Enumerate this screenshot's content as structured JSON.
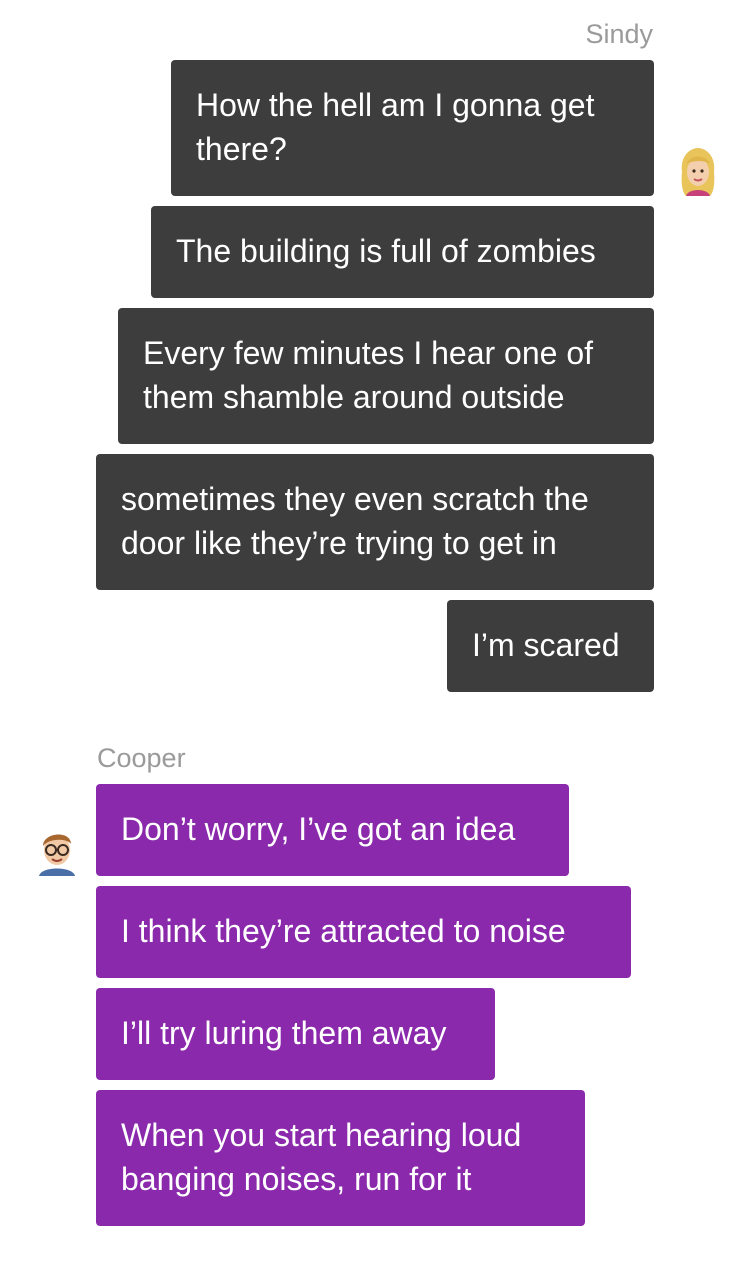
{
  "thread": {
    "sindy": {
      "name": "Sindy",
      "avatar_icon": "blonde-woman-avatar-icon",
      "bubble_color": "#3d3d3d",
      "messages": [
        "How the hell am I gonna get\nthere?",
        "The building is full of zombies",
        "Every few minutes I hear one of\nthem shamble around outside",
        "sometimes they even scratch the\ndoor like they’re trying to get in",
        "I’m scared"
      ]
    },
    "cooper": {
      "name": "Cooper",
      "avatar_icon": "man-with-glasses-avatar-icon",
      "bubble_color": "#8a29ab",
      "messages": [
        "Don’t worry, I’ve got an idea",
        "I think they’re attracted to noise",
        "I’ll try luring them away",
        "When you start hearing loud\nbanging noises, run for it"
      ]
    }
  }
}
